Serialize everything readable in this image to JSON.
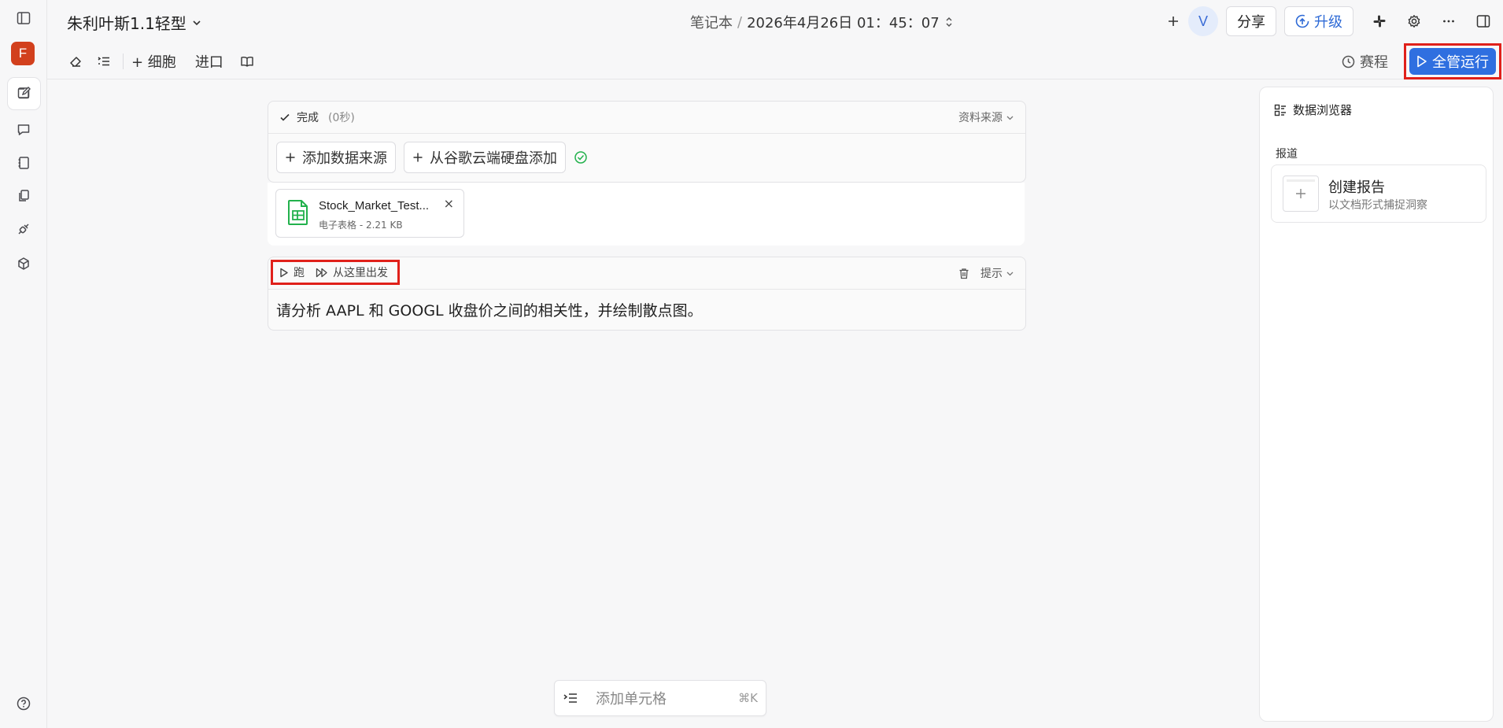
{
  "header": {
    "notebook_title": "朱利叶斯1.1轻型",
    "crumb_root": "笔记本",
    "crumb_sep": "/",
    "crumb_date": "2026年4月26日 01：45：07",
    "avatar_letter": "V",
    "share_label": "分享",
    "upgrade_label": "升级"
  },
  "rail": {
    "avatar_letter": "F"
  },
  "toolbar": {
    "add_cell_label": "+ 细胞",
    "import_label": "进口",
    "schedule_label": "赛程",
    "run_all_label": "全管运行"
  },
  "source_cell": {
    "status": "完成",
    "duration": "(0秒)",
    "source_menu": "资料来源",
    "add_source": "添加数据来源",
    "add_drive": "从谷歌云端硬盘添加"
  },
  "file": {
    "name": "Stock_Market_Test...",
    "meta": "电子表格 - 2.21 KB",
    "close": "×"
  },
  "prompt_cell": {
    "run_label": "跑",
    "run_from_here_label": "从这里出发",
    "hint_label": "提示",
    "text": "请分析 AAPL 和 GOOGL 收盘价之间的相关性，并绘制散点图。"
  },
  "add_cell_bar": {
    "placeholder": "添加单元格",
    "shortcut": "⌘K"
  },
  "right_panel": {
    "title": "数据浏览器",
    "section": "报道",
    "report_title": "创建报告",
    "report_sub": "以文档形式捕捉洞察"
  },
  "colors": {
    "accent": "#2f6fe0",
    "highlight": "#e0201a",
    "rail_avatar": "#d2401d",
    "success": "#22b14c"
  }
}
